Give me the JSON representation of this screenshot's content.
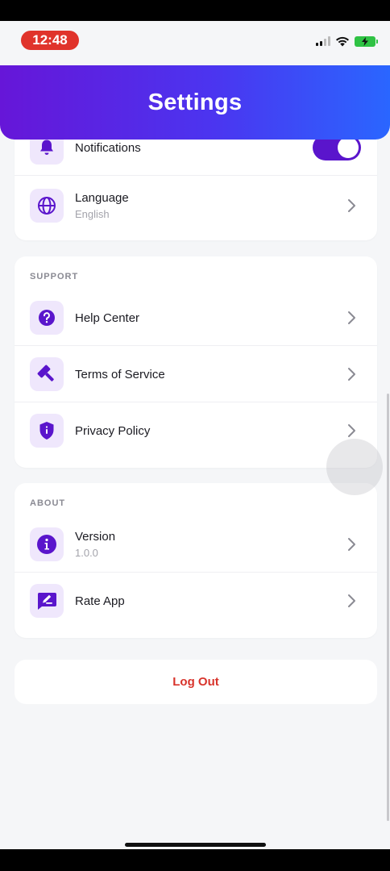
{
  "status_bar": {
    "time": "12:48"
  },
  "header": {
    "title": "Settings"
  },
  "preferences": {
    "items": [
      {
        "title": "Notifications",
        "icon": "bell-icon",
        "toggle_on": true
      },
      {
        "title": "Language",
        "subtitle": "English",
        "icon": "globe-icon"
      }
    ]
  },
  "support": {
    "label": "SUPPORT",
    "items": [
      {
        "title": "Help Center",
        "icon": "help-icon"
      },
      {
        "title": "Terms of Service",
        "icon": "gavel-icon"
      },
      {
        "title": "Privacy Policy",
        "icon": "shield-icon"
      }
    ]
  },
  "about": {
    "label": "ABOUT",
    "items": [
      {
        "title": "Version",
        "subtitle": "1.0.0",
        "icon": "info-icon"
      },
      {
        "title": "Rate App",
        "icon": "rate-icon"
      }
    ]
  },
  "logout": {
    "label": "Log Out"
  },
  "colors": {
    "accent": "#5a15cc",
    "header_gradient_start": "#6616d8",
    "header_gradient_end": "#2a66ff",
    "icon_bg": "#efe7fc",
    "logout": "#d8342c",
    "time_pill": "#e0332b"
  }
}
